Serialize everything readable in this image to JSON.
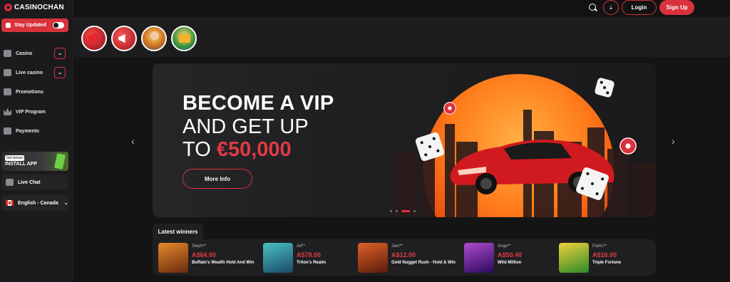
{
  "brand": {
    "name": "CASINOCHAN",
    "accent": "#d8323c"
  },
  "sidebar": {
    "stay_updated": "Stay Updated",
    "items": [
      {
        "label": "Casino",
        "icon": "cards-icon",
        "has_expand": true
      },
      {
        "label": "Live casino",
        "icon": "live-dealer-icon",
        "has_expand": true
      },
      {
        "label": "Promotions",
        "icon": "megaphone-icon",
        "has_expand": false
      },
      {
        "label": "VIP Program",
        "icon": "crown-icon",
        "has_expand": false
      },
      {
        "label": "Payments",
        "icon": "wallet-icon",
        "has_expand": false
      }
    ],
    "install": {
      "badge": "Get bonus",
      "label": "INSTALL APP"
    },
    "live_chat": "Live Chat",
    "language": "English - Canada"
  },
  "header": {
    "login": "Login",
    "signup": "Sign Up"
  },
  "banner": {
    "line1": "BECOME A VIP",
    "line2": "AND GET UP",
    "line3_prefix": "TO",
    "line3_amount": "€50,000",
    "cta": "More Info",
    "slides_total": 4,
    "active_slide": 3
  },
  "winners": {
    "title": "Latest winners",
    "items": [
      {
        "user": "Steph**",
        "amount": "A$64.00",
        "game": "Buffalo's Wealth Hold And Win",
        "thumb_color": "#b5521c"
      },
      {
        "user": "Ad**",
        "amount": "A$78.00",
        "game": "Triton's Realm",
        "thumb_color": "#2d8a8a"
      },
      {
        "user": "Jam**",
        "amount": "A$12.00",
        "game": "Gold Nugget Rush - Hold & Win",
        "thumb_color": "#a8341a"
      },
      {
        "user": "Ange**",
        "amount": "A$50.40",
        "game": "Wild Million",
        "thumb_color": "#5a2da0"
      },
      {
        "user": "Patric**",
        "amount": "A$16.00",
        "game": "Triple Fortune",
        "thumb_color": "#3aa02d"
      }
    ]
  }
}
